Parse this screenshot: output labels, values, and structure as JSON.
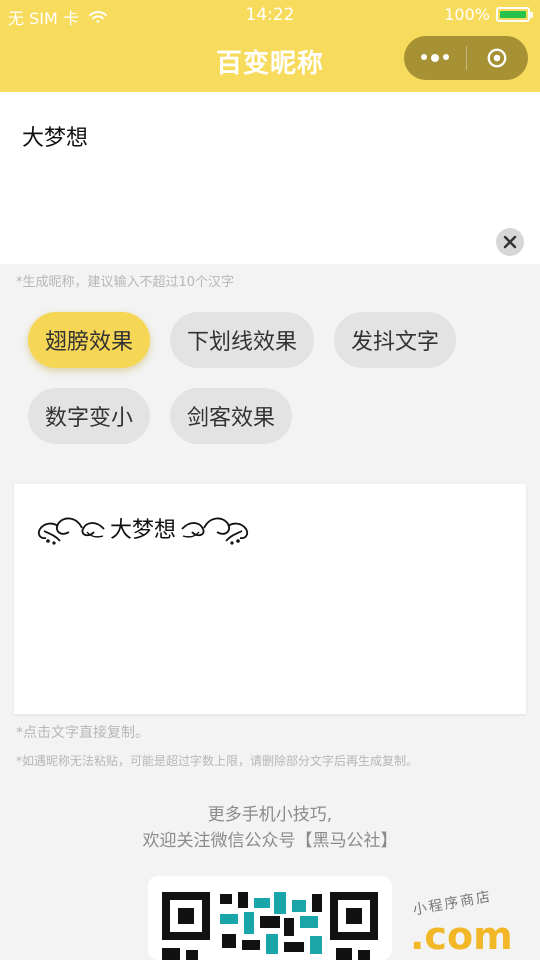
{
  "status": {
    "carrier": "无 SIM 卡",
    "time": "14:22",
    "battery": "100%"
  },
  "nav": {
    "title": "百变昵称"
  },
  "input": {
    "value": "大梦想",
    "hint": "*生成昵称，建议输入不超过10个汉字"
  },
  "effects": [
    {
      "label": "翅膀效果",
      "active": true
    },
    {
      "label": "下划线效果",
      "active": false
    },
    {
      "label": "发抖文字",
      "active": false
    },
    {
      "label": "数字变小",
      "active": false
    },
    {
      "label": "剑客效果",
      "active": false
    }
  ],
  "result": {
    "text": "大梦想"
  },
  "notes": {
    "copy": "*点击文字直接复制。",
    "paste": "*如遇昵称无法粘贴，可能是超过字数上限，请删除部分文字后再生成复制。"
  },
  "promo": {
    "line1": "更多手机小技巧,",
    "line2": "欢迎关注微信公众号【黑马公社】"
  },
  "watermark": {
    "text": "小程序商店",
    "dotcom": ".com"
  },
  "colors": {
    "brand": "#f7db5c",
    "active_chip": "#f6d655",
    "chip": "#e3e3e3",
    "battery": "#27c24c"
  }
}
